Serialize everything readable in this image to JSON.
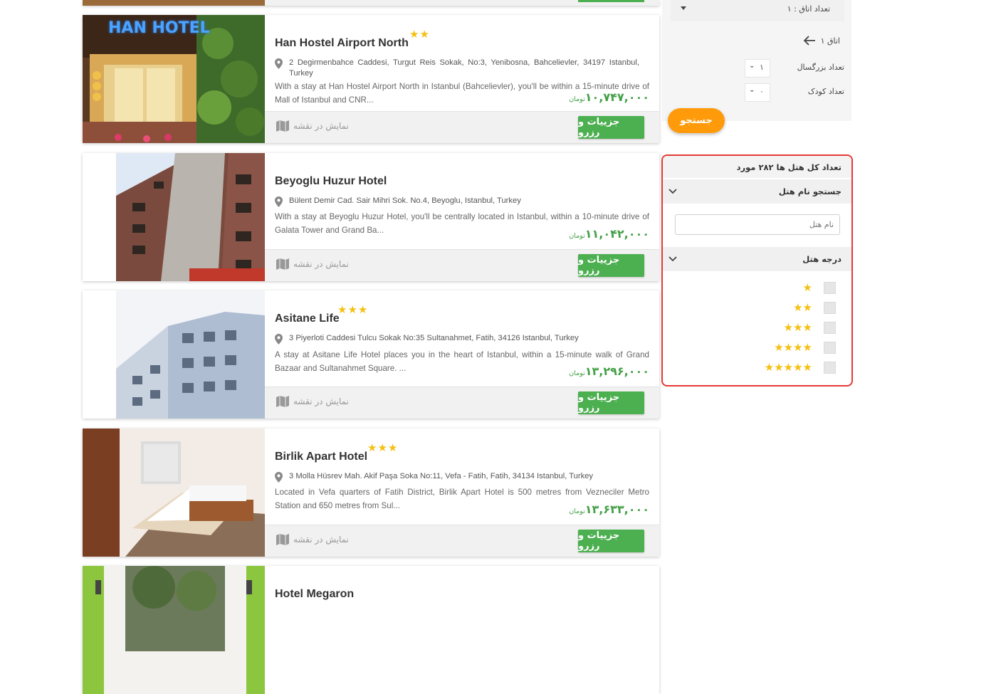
{
  "hotels_partial_top": {
    "note": ""
  },
  "hotels": [
    {
      "name": "Han Hostel Airport North",
      "stars": "★★",
      "address": "2 Degirmenbahce Caddesi, Turgut Reis Sokak, No:3, Yenibosna, Bahcelievler, 34197 Istanbul, Turkey",
      "description": "With a stay at Han Hostel Airport North in Istanbul (Bahcelievler), you'll be within a 15-minute drive of Mall of Istanbul and CNR...",
      "price": "۱۰,۷۴۷,۰۰۰",
      "currency": "تومان",
      "map_label": "نمایش در نقشه",
      "book_label": "جزییات و رزرو",
      "image_sign": "HAN HOTEL"
    },
    {
      "name": "Beyoglu Huzur Hotel",
      "stars": "",
      "address": "Bülent Demir Cad. Sair Mihri Sok. No.4, Beyoglu, Istanbul, Turkey",
      "description": "With a stay at Beyoglu Huzur Hotel, you'll be centrally located in Istanbul, within a 10-minute drive of Galata Tower and Grand Ba...",
      "price": "۱۱,۰۴۲,۰۰۰",
      "currency": "تومان",
      "map_label": "نمایش در نقشه",
      "book_label": "جزییات و رزرو"
    },
    {
      "name": "Asitane Life",
      "stars": "★★★",
      "address": "3 Piyerloti Caddesi Tulcu Sokak No:35 Sultanahmet, Fatih, 34126 Istanbul, Turkey",
      "description": "A stay at Asitane Life Hotel places you in the heart of Istanbul, within a 15-minute walk of Grand Bazaar and Sultanahmet Square. ...",
      "price": "۱۳,۲۹۶,۰۰۰",
      "currency": "تومان",
      "map_label": "نمایش در نقشه",
      "book_label": "جزییات و رزرو"
    },
    {
      "name": "Birlik Apart Hotel",
      "stars": "★★★",
      "address": "3 Molla Hüsrev Mah. Akif Paşa Soka No:11, Vefa - Fatih, Fatih, 34134 Istanbul, Turkey",
      "description": "Located in Vefa quarters of Fatih District, Birlik Apart Hotel is 500 metres from Vezneciler Metro Station and 650 metres from Sul...",
      "price": "۱۳,۶۳۳,۰۰۰",
      "currency": "تومان",
      "map_label": "نمایش در نقشه",
      "book_label": "جزییات و رزرو"
    },
    {
      "name": "Hotel Megaron"
    }
  ],
  "search_panel": {
    "rooms_count_label": "تعداد اتاق : ۱",
    "room_label": "اتاق ۱",
    "adults_label": "تعداد بزرگسال",
    "adults_value": "۱",
    "children_label": "تعداد کودک",
    "children_value": "۰",
    "search_button": "جستجو"
  },
  "filters": {
    "total_label": "تعداد کل هتل ها ۲۸۲ مورد",
    "name_search_title": "جستجو نام هتل",
    "name_placeholder": "نام هتل",
    "stars_title": "درجه هتل",
    "star_options": [
      "★",
      "★★",
      "★★★",
      "★★★★",
      "★★★★★"
    ]
  },
  "colors": {
    "accent_green": "#4caf50",
    "price_green": "#43a047",
    "search_orange": "#ff9b0a",
    "star_yellow": "#f5c010",
    "highlight_red": "#e53935"
  }
}
